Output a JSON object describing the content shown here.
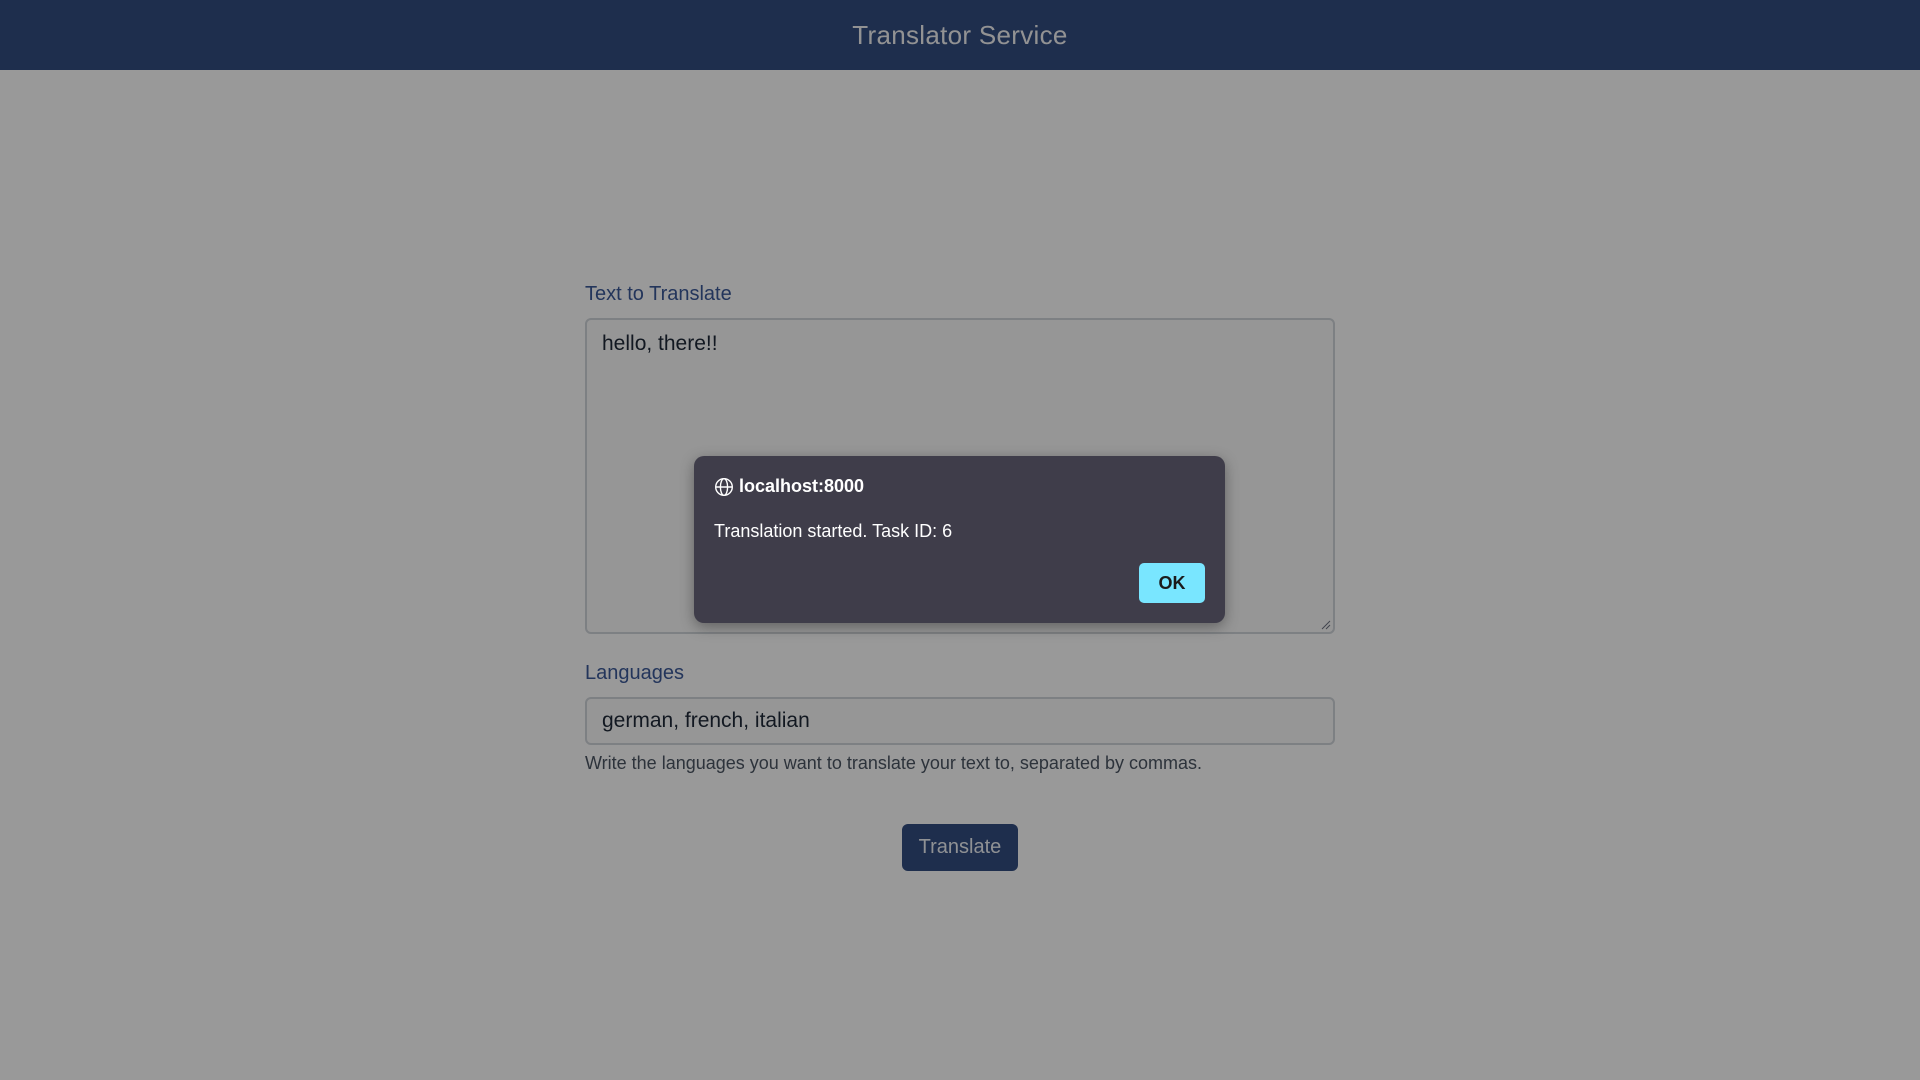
{
  "header": {
    "title": "Translator Service"
  },
  "form": {
    "text_label": "Text to Translate",
    "text_value": "hello, there!!",
    "languages_label": "Languages",
    "languages_value": "german, french, italian",
    "languages_help": "Write the languages you want to translate your text to, separated by commas.",
    "submit_label": "Translate"
  },
  "dialog": {
    "origin": "localhost:8000",
    "origin_icon": "globe-icon",
    "message": "Translation started. Task ID: 6",
    "ok_label": "OK"
  },
  "colors": {
    "header_bg": "#334d80",
    "label": "#3b5998",
    "dialog_bg": "#3f3d4a",
    "ok_button": "#79e6ff"
  }
}
